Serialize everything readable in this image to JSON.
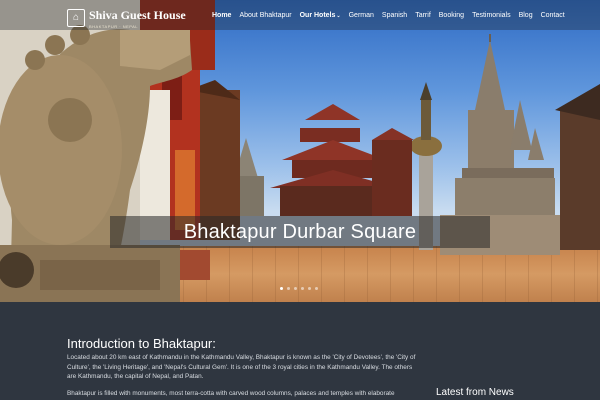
{
  "header": {
    "logo_text": "Shiva Guest House",
    "logo_tagline": "BHAKTAPUR · NEPAL",
    "nav": [
      {
        "label": "Home",
        "active": true
      },
      {
        "label": "About Bhaktapur",
        "active": false
      },
      {
        "label": "Our Hotels",
        "active": true,
        "has_dropdown": true
      },
      {
        "label": "German",
        "active": false
      },
      {
        "label": "Spanish",
        "active": false
      },
      {
        "label": "Tarrif",
        "active": false
      },
      {
        "label": "Booking",
        "active": false
      },
      {
        "label": "Testimonials",
        "active": false
      },
      {
        "label": "Blog",
        "active": false
      },
      {
        "label": "Contact",
        "active": false
      }
    ]
  },
  "hero": {
    "caption": "Bhaktapur Durbar Square",
    "slide_count": 6,
    "active_slide": 1
  },
  "main": {
    "intro_title": "Introduction to Bhaktapur:",
    "intro_paragraph_1": "Located about 20 km east of Kathmandu in the Kathmandu Valley, Bhaktapur is known as the 'City of Devotees', the 'City of Culture', the 'Living Heritage', and 'Nepal's Cultural Gem'. It is one of the 3 royal cities in the Kathmandu Valley. The others are Kathmandu, the capital of Nepal, and Patan.",
    "intro_paragraph_2": "Bhaktapur is filled with monuments, most terra-cotta with carved wood columns, palaces and temples with elaborate",
    "news_title": "Latest from News"
  },
  "colors": {
    "content_bg": "#2f3640",
    "sky_top": "#2f6bc4",
    "brick": "#c7834c"
  }
}
